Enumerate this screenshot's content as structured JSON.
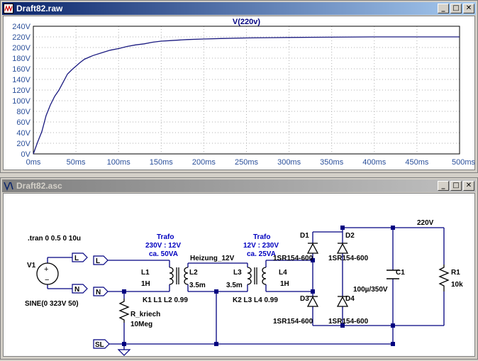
{
  "plot_window": {
    "title": "Draft82.raw",
    "controls": [
      "_",
      "□",
      "✕"
    ]
  },
  "schematic_window": {
    "title": "Draft82.asc",
    "controls": [
      "_",
      "□",
      "✕"
    ]
  },
  "colors": {
    "trace": "#1a1a80",
    "grid": "#b0b0b0",
    "axis_label": "#2a4f9a",
    "schematic_wire": "#000080",
    "schematic_text": "#000000",
    "schematic_blue_text": "#0000c0",
    "title_active": "#0a246a",
    "title_inactive": "#808080"
  },
  "chart_data": {
    "type": "line",
    "title": "V(220v)",
    "xlabel": "",
    "ylabel": "",
    "xlim": [
      0,
      500
    ],
    "ylim": [
      0,
      240
    ],
    "x_ticks": [
      "0ms",
      "50ms",
      "100ms",
      "150ms",
      "200ms",
      "250ms",
      "300ms",
      "350ms",
      "400ms",
      "450ms",
      "500ms"
    ],
    "y_ticks": [
      "0V",
      "20V",
      "40V",
      "60V",
      "80V",
      "100V",
      "120V",
      "140V",
      "160V",
      "180V",
      "200V",
      "220V",
      "240V"
    ],
    "grid": true,
    "series": [
      {
        "name": "V(220v)",
        "x": [
          0,
          5,
          10,
          15,
          20,
          25,
          30,
          35,
          40,
          45,
          50,
          55,
          60,
          70,
          80,
          90,
          100,
          110,
          120,
          130,
          140,
          150,
          160,
          180,
          200,
          220,
          250,
          280,
          300,
          350,
          400,
          450,
          500
        ],
        "values": [
          0,
          22,
          42,
          72,
          92,
          108,
          120,
          135,
          150,
          158,
          165,
          172,
          178,
          185,
          190,
          195,
          198,
          202,
          205,
          207,
          210,
          212,
          213,
          215,
          216,
          217,
          218,
          218.5,
          219,
          219.5,
          220,
          220,
          220
        ]
      }
    ]
  },
  "schematic": {
    "directive": ".tran 0 0.5 0 10u",
    "v1_name": "V1",
    "v1_value": "SINE(0 323V 50)",
    "flag_L_left": "L",
    "flag_N_left": "N",
    "flag_L_right": "L",
    "flag_N_right": "N",
    "flag_SL": "SL",
    "trafo1_title": "Trafo",
    "trafo1_ratio": "230V : 12V",
    "trafo1_power": "ca. 50VA",
    "trafo2_title": "Trafo",
    "trafo2_ratio": "12V : 230V",
    "trafo2_power": "ca. 25VA",
    "l1_name": "L1",
    "l1_value": "1H",
    "l2_name": "L2",
    "l2_value": "3.5m",
    "l3_name": "L3",
    "l3_value": "3.5m",
    "l4_name": "L4",
    "l4_value": "1H",
    "k1": "K1 L1 L2 0.99",
    "k2": "K2 L3 L4 0.99",
    "heizung_label": "Heizung_12V",
    "r_kriech_name": "R_kriech",
    "r_kriech_value": "10Meg",
    "d1_name": "D1",
    "d2_name": "D2",
    "d3_name": "D3",
    "d4_name": "D4",
    "diode_model": "1SR154-600",
    "c1_name": "C1",
    "c1_value": "100µ/350V",
    "r1_name": "R1",
    "r1_value": "10k",
    "net_220v": "220V"
  }
}
